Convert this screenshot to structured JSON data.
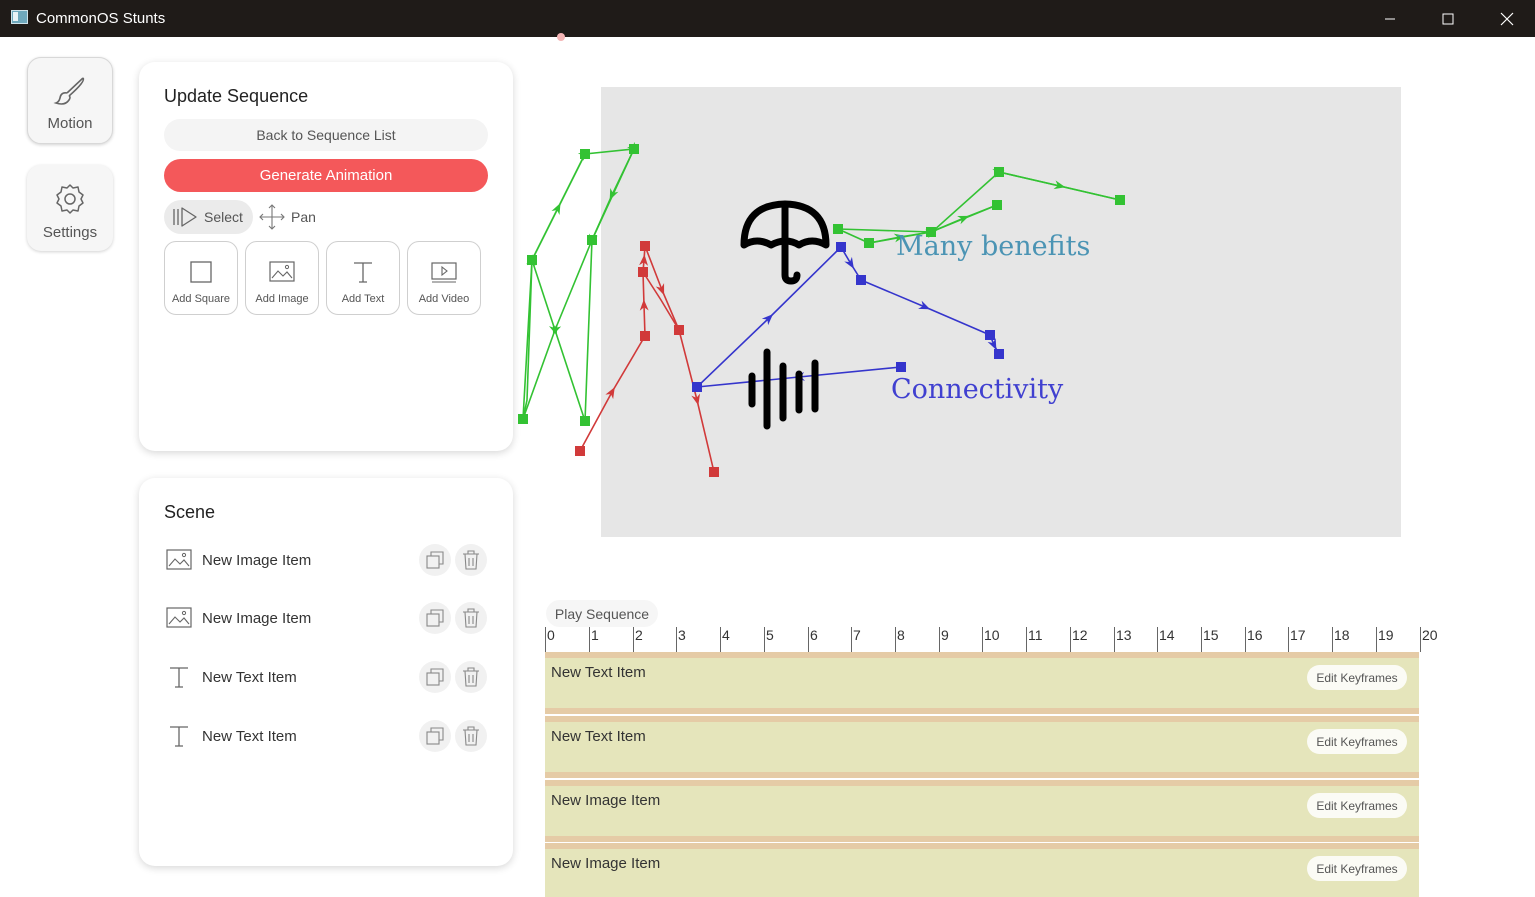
{
  "window": {
    "title": "CommonOS Stunts"
  },
  "rail": {
    "motion_label": "Motion",
    "settings_label": "Settings"
  },
  "sequence_panel": {
    "title": "Update Sequence",
    "back_label": "Back to Sequence List",
    "generate_label": "Generate Animation",
    "select_label": "Select",
    "pan_label": "Pan",
    "add_items": [
      {
        "label": "Add Square",
        "icon": "square-icon"
      },
      {
        "label": "Add Image",
        "icon": "image-icon"
      },
      {
        "label": "Add Text",
        "icon": "text-icon"
      },
      {
        "label": "Add Video",
        "icon": "video-icon"
      }
    ]
  },
  "scene_panel": {
    "title": "Scene",
    "items": [
      {
        "label": "New Image Item",
        "icon": "image-icon"
      },
      {
        "label": "New Image Item",
        "icon": "image-icon"
      },
      {
        "label": "New Text Item",
        "icon": "text-icon"
      },
      {
        "label": "New Text Item",
        "icon": "text-icon"
      }
    ]
  },
  "canvas": {
    "texts": [
      {
        "text": "Many benefits",
        "color": "#4b94b4"
      },
      {
        "text": "Connectivity",
        "color": "#4040d0"
      }
    ],
    "path_colors": {
      "green": "#33c233",
      "red": "#d13a3a",
      "blue": "#3535cc"
    }
  },
  "timeline": {
    "play_label": "Play Sequence",
    "ticks": [
      "0",
      "1",
      "2",
      "3",
      "4",
      "5",
      "6",
      "7",
      "8",
      "9",
      "10",
      "11",
      "12",
      "13",
      "14",
      "15",
      "16",
      "17",
      "18",
      "19",
      "20"
    ],
    "tracks": [
      {
        "label": "New Text Item",
        "button": "Edit Keyframes"
      },
      {
        "label": "New Text Item",
        "button": "Edit Keyframes"
      },
      {
        "label": "New Image Item",
        "button": "Edit Keyframes"
      },
      {
        "label": "New Image Item",
        "button": "Edit Keyframes"
      }
    ]
  }
}
